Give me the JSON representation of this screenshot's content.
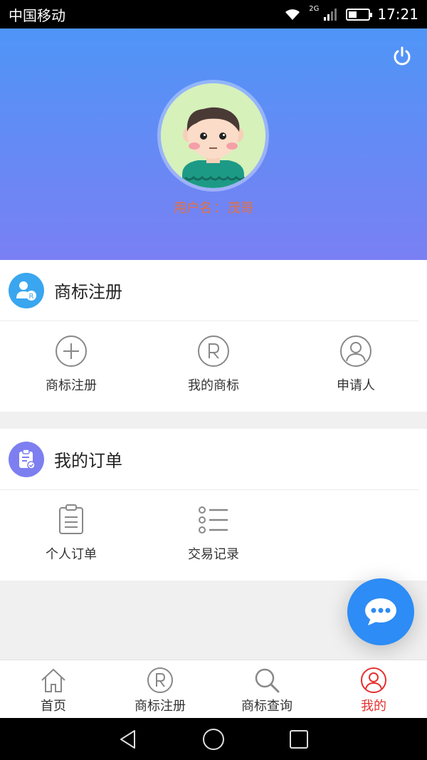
{
  "status_bar": {
    "carrier": "中国移动",
    "network": "2G",
    "time": "17:21"
  },
  "profile": {
    "username_label": "用户名",
    "separator": "：",
    "username": "茂哥"
  },
  "trademark_section": {
    "title": "商标注册",
    "items": [
      {
        "label": "商标注册",
        "icon": "plus-circle-icon"
      },
      {
        "label": "我的商标",
        "icon": "registered-icon"
      },
      {
        "label": "申请人",
        "icon": "person-icon"
      }
    ]
  },
  "orders_section": {
    "title": "我的订单",
    "items": [
      {
        "label": "个人订单",
        "icon": "clipboard-icon"
      },
      {
        "label": "交易记录",
        "icon": "list-icon"
      }
    ]
  },
  "tabs": [
    {
      "label": "首页",
      "icon": "home-icon"
    },
    {
      "label": "商标注册",
      "icon": "registered-icon"
    },
    {
      "label": "商标查询",
      "icon": "search-icon"
    },
    {
      "label": "我的",
      "icon": "user-icon",
      "active": true
    }
  ],
  "colors": {
    "accent": "#e63030",
    "header_top": "#4f95f7",
    "header_bottom": "#7a80f3",
    "fab": "#2d8cf5",
    "username": "#e8703a"
  }
}
